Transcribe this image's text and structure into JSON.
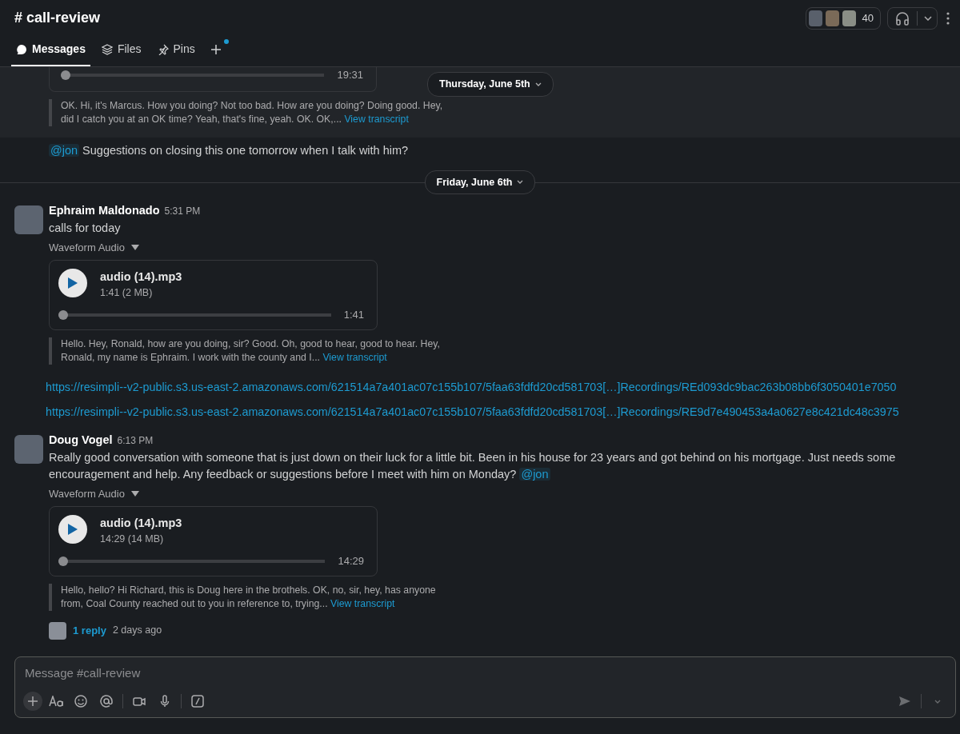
{
  "channel": {
    "title": "# call-review",
    "member_count": "40"
  },
  "tabs": [
    {
      "label": "Messages",
      "selected": true
    },
    {
      "label": "Files",
      "selected": false
    },
    {
      "label": "Pins",
      "selected": false
    }
  ],
  "sticky_date": "Thursday, June 5th",
  "feed": [
    {
      "kind": "partial",
      "audio": {
        "duration": "19:31",
        "level": 0
      },
      "transcript": {
        "text": "OK. Hi, it's Marcus. How you doing? Not too bad. How are you doing? Doing good. Hey, did I catch you at an OK time? Yeah, that's fine, yeah. OK. OK,...",
        "link": "View transcript"
      }
    },
    {
      "kind": "continuation",
      "mention": "@jon",
      "text": "Suggestions on closing this one tomorrow when I talk with him?"
    },
    {
      "kind": "date",
      "label": "Friday, June 6th"
    },
    {
      "kind": "message",
      "author": "Ephraim Maldonado",
      "time": "5:31 PM",
      "text": "calls for today",
      "attachment_label": "Waveform Audio",
      "audio": {
        "name": "audio (14).mp3",
        "meta": "1:41 (2 MB)",
        "duration": "1:41",
        "level": 0
      },
      "transcript": {
        "text": "Hello. Hey, Ronald, how are you doing, sir? Good. Oh, good to hear, good to hear. Hey, Ronald, my name is Ephraim. I work with the county and I...",
        "link": "View transcript"
      },
      "links": [
        "https://resimpli--v2-public.s3.us-east-2.amazonaws.com/621514a7a401ac07c155b107/5faa63fdfd20cd581703[…]Recordings/REd093dc9bac263b08bb6f3050401e7050",
        "https://resimpli--v2-public.s3.us-east-2.amazonaws.com/621514a7a401ac07c155b107/5faa63fdfd20cd581703[…]Recordings/RE9d7e490453a4a0627e8c421dc48c3975"
      ]
    },
    {
      "kind": "message",
      "author": "Doug Vogel",
      "time": "6:13 PM",
      "text": "Really good conversation with someone that is just down on their luck for a little bit. Been in his house for 23 years and got behind on his mortgage. Just needs some encouragement and help. Any feedback or suggestions before I meet with him on Monday?",
      "mention": "@jon",
      "attachment_label": "Waveform Audio",
      "audio": {
        "name": "audio (14).mp3",
        "meta": "14:29 (14 MB)",
        "duration": "14:29",
        "level": 0
      },
      "transcript": {
        "text": "Hello, hello? Hi Richard, this is Doug here in the brothels. OK, no, sir, hey, has anyone from, Coal County reached out to you in reference to, trying...",
        "link": "View transcript"
      },
      "reply": {
        "count": "1 reply",
        "when": "2 days ago"
      }
    }
  ],
  "composer": {
    "placeholder": "Message #call-review"
  }
}
